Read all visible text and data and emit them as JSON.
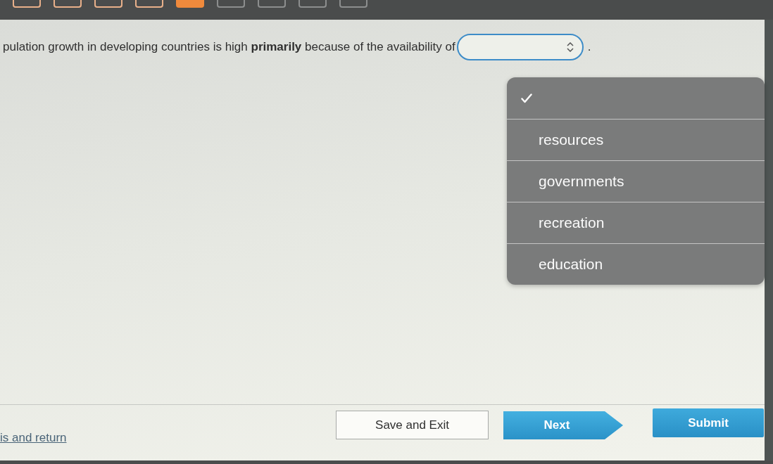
{
  "question_nav": [
    {
      "answered": true,
      "selected": false
    },
    {
      "answered": true,
      "selected": false
    },
    {
      "answered": true,
      "selected": false
    },
    {
      "answered": true,
      "selected": false
    },
    {
      "answered": false,
      "selected": true
    },
    {
      "answered": false,
      "selected": false
    },
    {
      "answered": false,
      "selected": false
    },
    {
      "answered": false,
      "selected": false
    },
    {
      "answered": false,
      "selected": false
    }
  ],
  "question": {
    "text": "pulation growth in developing countries is high **primarily** because of the availability of",
    "trailing": "."
  },
  "select": {
    "expanded": true,
    "options": [
      {
        "selected": true
      },
      {
        "label": "resources",
        "selected": false
      },
      {
        "label": "governments",
        "selected": false
      },
      {
        "label": "recreation",
        "selected": false
      },
      {
        "label": "education",
        "selected": false
      }
    ]
  },
  "footer": {
    "link": "is and return",
    "buttons": [
      {
        "label": "Save and Exit",
        "kind": "secondary"
      },
      {
        "label": "Next",
        "kind": "next"
      },
      {
        "label": "Submit",
        "kind": "primary"
      }
    ]
  }
}
